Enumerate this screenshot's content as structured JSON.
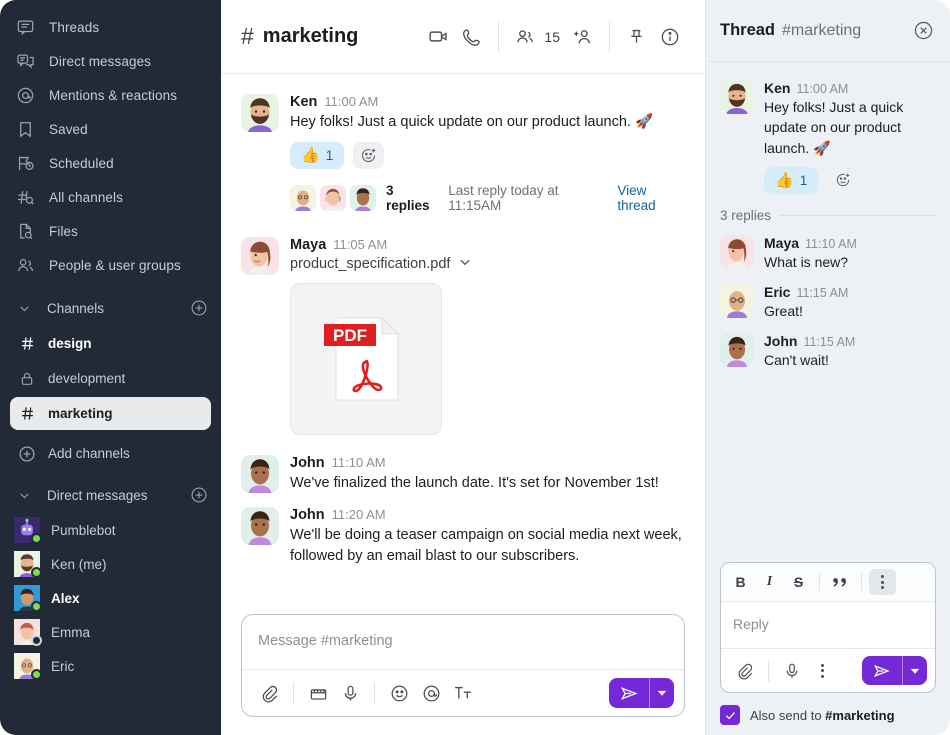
{
  "theme": {
    "sidebar_bg": "#212a36",
    "accent": "#7528d6",
    "link": "#1264a3",
    "thread_bg": "#edf1f5",
    "reaction_bg": "#d6ecfb"
  },
  "sidebar": {
    "nav": [
      {
        "label": "Threads",
        "icon": "threads-icon"
      },
      {
        "label": "Direct messages",
        "icon": "direct-messages-icon"
      },
      {
        "label": "Mentions & reactions",
        "icon": "mentions-icon"
      },
      {
        "label": "Saved",
        "icon": "bookmark-icon"
      },
      {
        "label": "Scheduled",
        "icon": "scheduled-icon"
      },
      {
        "label": "All channels",
        "icon": "all-channels-icon"
      },
      {
        "label": "Files",
        "icon": "files-icon"
      },
      {
        "label": "People & user groups",
        "icon": "people-icon"
      }
    ],
    "channels_section": {
      "title": "Channels",
      "add_icon": "plus-circle-icon",
      "chevron": "chevron-down-icon"
    },
    "channels": [
      {
        "label": "design",
        "icon": "hash-icon",
        "unread": true,
        "active": false
      },
      {
        "label": "development",
        "icon": "lock-icon",
        "unread": false,
        "active": false
      },
      {
        "label": "marketing",
        "icon": "hash-icon",
        "unread": false,
        "active": true
      }
    ],
    "add_channels": {
      "label": "Add channels",
      "icon": "plus-circle-icon"
    },
    "dms_section": {
      "title": "Direct messages",
      "add_icon": "plus-circle-icon",
      "chevron": "chevron-down-icon"
    },
    "dms": [
      {
        "label": "Pumblebot",
        "status": "online",
        "unread": false
      },
      {
        "label": "Ken (me)",
        "status": "online",
        "unread": false
      },
      {
        "label": "Alex",
        "status": "online",
        "unread": true
      },
      {
        "label": "Emma",
        "status": "away",
        "unread": false
      },
      {
        "label": "Eric",
        "status": "online",
        "unread": false
      }
    ]
  },
  "main": {
    "header": {
      "hash": "#",
      "channel": "marketing",
      "member_count": "15",
      "icons": [
        "video-camera-icon",
        "phone-icon",
        "members-icon",
        "add-member-icon",
        "pin-icon",
        "info-icon"
      ]
    },
    "messages": [
      {
        "author": "Ken",
        "time": "11:00 AM",
        "text": "Hey folks! Just a quick update on our product launch. 🚀",
        "reaction": {
          "emoji": "👍",
          "count": "1"
        },
        "thread": {
          "replies": "3 replies",
          "meta": "Last reply today at 11:15AM",
          "link": "View thread"
        }
      },
      {
        "author": "Maya",
        "time": "11:05 AM",
        "file": {
          "name": "product_specification.pdf",
          "badge": "PDF"
        }
      },
      {
        "author": "John",
        "time": "11:10 AM",
        "text": "We've finalized the launch date. It's set for November 1st!"
      },
      {
        "author": "John",
        "time": "11:20 AM",
        "text": "We'll be doing a teaser campaign on social media next week, followed by an email blast to our subscribers."
      }
    ],
    "composer": {
      "placeholder": "Message #marketing",
      "tools": [
        "attach-icon",
        "clip-icon",
        "mic-icon",
        "emoji-icon",
        "mention-icon",
        "format-text-icon"
      ],
      "send_icon": "send-icon",
      "send_caret_icon": "caret-down-icon"
    }
  },
  "thread": {
    "header": {
      "title": "Thread",
      "channel": "#marketing",
      "close_icon": "close-icon"
    },
    "root": {
      "author": "Ken",
      "time": "11:00 AM",
      "text": "Hey folks! Just a quick update on our product launch. 🚀",
      "reaction": {
        "emoji": "👍",
        "count": "1"
      }
    },
    "replies_label": "3 replies",
    "replies": [
      {
        "author": "Maya",
        "time": "11:10 AM",
        "text": "What is new?"
      },
      {
        "author": "Eric",
        "time": "11:15 AM",
        "text": "Great!"
      },
      {
        "author": "John",
        "time": "11:15 AM",
        "text": "Can't wait!"
      }
    ],
    "composer": {
      "format": [
        "B",
        "I",
        "S",
        "❝",
        "kebab"
      ],
      "placeholder": "Reply",
      "tools": [
        "attach-icon",
        "mic-icon",
        "more-icon"
      ],
      "send_icon": "send-icon",
      "send_caret_icon": "caret-down-icon"
    },
    "also_send": {
      "prefix": "Also send to ",
      "channel": "#marketing",
      "checked": true
    }
  }
}
